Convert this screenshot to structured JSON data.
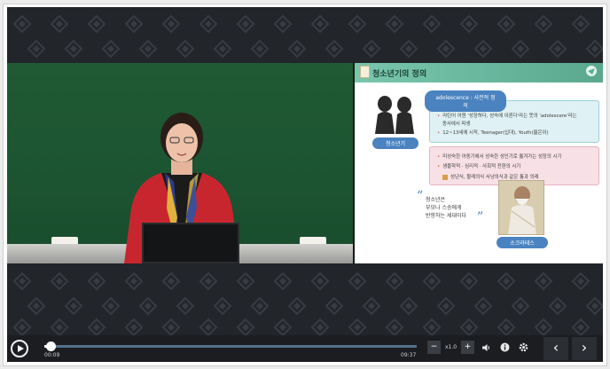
{
  "slide": {
    "header_title": "청소년기의 정의",
    "teen_tag": "청소년기",
    "definition_label": "adolescence : 사전적 정의",
    "blue_bullets": [
      "라틴어 어원 '성장하다, 성숙에 이른다'라는 뜻의 'adolescere'라는",
      "동사에서 파생",
      "12~13세에 시작, Teenager(십대), Youth(젊은이)"
    ],
    "pink_bullets": [
      "미성숙한 아동기에서 성숙한 성인기로 옮겨가는 성장의 시기",
      "생물학적 · 심리적 · 사회적 전환의 시기",
      "성년식, 할례의식 사냥의식과 같은 통과 의례"
    ],
    "quote_lines": [
      "청소년은",
      "부모나 스승에게",
      "반항하는 세대이다"
    ],
    "quote_open": "“",
    "quote_close": "”",
    "philosopher_tag": "소크라테스"
  },
  "player": {
    "current_time": "00:09",
    "duration": "09:37",
    "progress_fraction": 0.016,
    "speed": "x1.0",
    "minus_label": "−",
    "plus_label": "+",
    "prev_label": "‹",
    "next_label": "›"
  },
  "colors": {
    "accent_teal": "#5aa98f",
    "accent_blue": "#4a83c0",
    "board_green": "#1c5431"
  }
}
